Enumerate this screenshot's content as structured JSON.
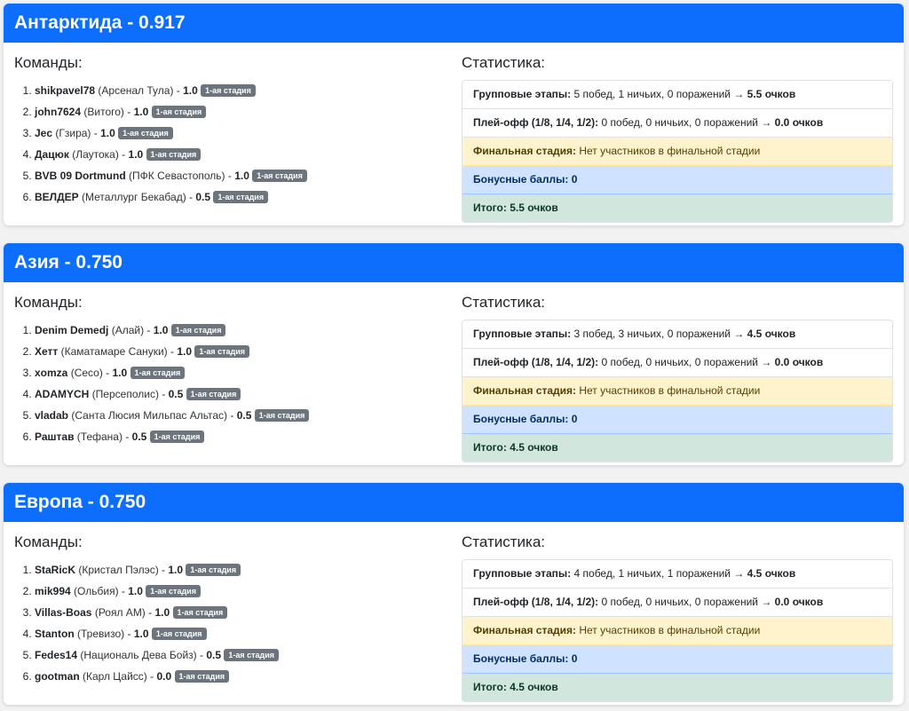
{
  "labels": {
    "teams_title": "Команды:",
    "stats_title": "Статистика:",
    "group_label": "Групповые этапы:",
    "playoff_label": "Плей-офф (1/8, 1/4, 1/2):",
    "final_label": "Финальная стадия:",
    "final_text": "Нет участников в финальной стадии",
    "bonus_label": "Бонусные баллы:",
    "total_label": "Итого:"
  },
  "groups": [
    {
      "title": "Антарктида - 0.917",
      "teams": [
        {
          "name": "shikpavel78",
          "club": "(Арсенал Тула)",
          "score": "1.0",
          "badge": "1-ая стадия"
        },
        {
          "name": "john7624",
          "club": "(Витого)",
          "score": "1.0",
          "badge": "1-ая стадия"
        },
        {
          "name": "Jec",
          "club": "(Гзира)",
          "score": "1.0",
          "badge": "1-ая стадия"
        },
        {
          "name": "Дацюк",
          "club": "(Лаутока)",
          "score": "1.0",
          "badge": "1-ая стадия"
        },
        {
          "name": "BVB 09 Dortmund",
          "club": "(ПФК Севастополь)",
          "score": "1.0",
          "badge": "1-ая стадия"
        },
        {
          "name": "ВЕЛДЕР",
          "club": "(Металлург Бекабад)",
          "score": "0.5",
          "badge": "1-ая стадия"
        }
      ],
      "stats": {
        "group_text": "5 побед, 1 ничьих, 0 поражений →",
        "group_result": "5.5 очков",
        "playoff_text": "0 побед, 0 ничьих, 0 поражений →",
        "playoff_result": "0.0 очков",
        "bonus_value": "0",
        "total_value": "5.5 очков"
      }
    },
    {
      "title": "Азия - 0.750",
      "teams": [
        {
          "name": "Denim Demedj",
          "club": "(Алай)",
          "score": "1.0",
          "badge": "1-ая стадия"
        },
        {
          "name": "Хетт",
          "club": "(Каматамаре Сануки)",
          "score": "1.0",
          "badge": "1-ая стадия"
        },
        {
          "name": "xomza",
          "club": "(Сесо)",
          "score": "1.0",
          "badge": "1-ая стадия"
        },
        {
          "name": "ADAMYCH",
          "club": "(Персеполис)",
          "score": "0.5",
          "badge": "1-ая стадия"
        },
        {
          "name": "vladab",
          "club": "(Санта Люсия Мильпас Альтас)",
          "score": "0.5",
          "badge": "1-ая стадия"
        },
        {
          "name": "Раштав",
          "club": "(Тефана)",
          "score": "0.5",
          "badge": "1-ая стадия"
        }
      ],
      "stats": {
        "group_text": "3 побед, 3 ничьих, 0 поражений →",
        "group_result": "4.5 очков",
        "playoff_text": "0 побед, 0 ничьих, 0 поражений →",
        "playoff_result": "0.0 очков",
        "bonus_value": "0",
        "total_value": "4.5 очков"
      }
    },
    {
      "title": "Европа - 0.750",
      "teams": [
        {
          "name": "StaRicK",
          "club": "(Кристал Пэлэс)",
          "score": "1.0",
          "badge": "1-ая стадия"
        },
        {
          "name": "mik994",
          "club": "(Ольбия)",
          "score": "1.0",
          "badge": "1-ая стадия"
        },
        {
          "name": "Villas-Boas",
          "club": "(Роял АМ)",
          "score": "1.0",
          "badge": "1-ая стадия"
        },
        {
          "name": "Stanton",
          "club": "(Тревизо)",
          "score": "1.0",
          "badge": "1-ая стадия"
        },
        {
          "name": "Fedes14",
          "club": "(Националь Дева Бойз)",
          "score": "0.5",
          "badge": "1-ая стадия"
        },
        {
          "name": "gootman",
          "club": "(Карл Цайсс)",
          "score": "0.0",
          "badge": "1-ая стадия"
        }
      ],
      "stats": {
        "group_text": "4 побед, 1 ничьих, 1 поражений →",
        "group_result": "4.5 очков",
        "playoff_text": "0 побед, 0 ничьих, 0 поражений →",
        "playoff_result": "0.0 очков",
        "bonus_value": "0",
        "total_value": "4.5 очков"
      }
    }
  ]
}
